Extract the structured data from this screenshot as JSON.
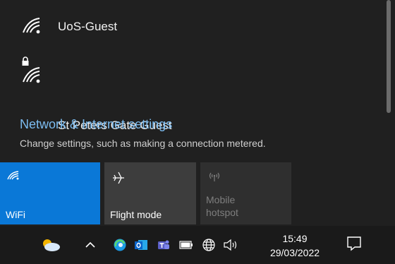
{
  "networks": [
    {
      "ssid": "UoS-Guest",
      "secured": false
    },
    {
      "ssid": "St Peters Gate Guest",
      "secured": true
    }
  ],
  "settings": {
    "link_text": "Network & Internet settings",
    "description": "Change settings, such as making a connection metered."
  },
  "quick_actions": [
    {
      "label": "WiFi",
      "icon": "wifi-icon",
      "state": "on"
    },
    {
      "label": "Flight mode",
      "icon": "airplane-icon",
      "state": "off"
    },
    {
      "label_line1": "Mobile",
      "label_line2": "hotspot",
      "icon": "hotspot-icon",
      "state": "disabled"
    }
  ],
  "taskbar": {
    "time": "15:49",
    "date": "29/03/2022",
    "tray_icons": [
      "weather-icon",
      "chevron-up-icon",
      "edge-icon",
      "outlook-icon",
      "teams-icon",
      "battery-icon",
      "network-globe-icon",
      "volume-icon",
      "notification-icon"
    ]
  },
  "colors": {
    "accent": "#0a78d7",
    "link": "#7cbcf0",
    "flyout_bg": "#202020",
    "taskbar_bg": "#1a1a1a"
  }
}
